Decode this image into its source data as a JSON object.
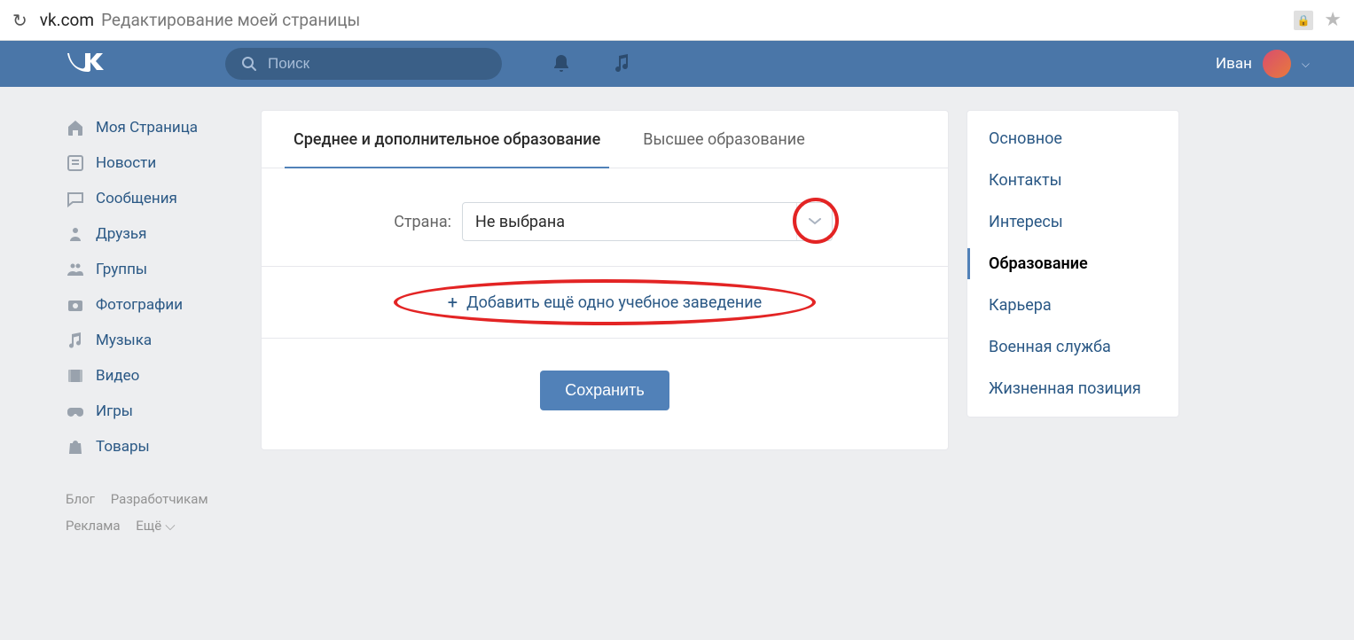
{
  "browser": {
    "domain": "vk.com",
    "title": "Редактирование моей страницы"
  },
  "header": {
    "search_placeholder": "Поиск",
    "user_name": "Иван"
  },
  "left_nav": {
    "items": [
      {
        "label": "Моя Страница"
      },
      {
        "label": "Новости"
      },
      {
        "label": "Сообщения"
      },
      {
        "label": "Друзья"
      },
      {
        "label": "Группы"
      },
      {
        "label": "Фотографии"
      },
      {
        "label": "Музыка"
      },
      {
        "label": "Видео"
      },
      {
        "label": "Игры"
      },
      {
        "label": "Товары"
      }
    ]
  },
  "footer": {
    "blog": "Блог",
    "developers": "Разработчикам",
    "ads": "Реклама",
    "more": "Ещё"
  },
  "main": {
    "tabs": [
      {
        "label": "Среднее и дополнительное образование",
        "active": true
      },
      {
        "label": "Высшее образование",
        "active": false
      }
    ],
    "country_label": "Страна:",
    "country_value": "Не выбрана",
    "add_school_label": "Добавить ещё одно учебное заведение",
    "save_label": "Сохранить"
  },
  "right_nav": {
    "items": [
      {
        "label": "Основное"
      },
      {
        "label": "Контакты"
      },
      {
        "label": "Интересы"
      },
      {
        "label": "Образование",
        "active": true
      },
      {
        "label": "Карьера"
      },
      {
        "label": "Военная служба"
      },
      {
        "label": "Жизненная позиция"
      }
    ]
  }
}
